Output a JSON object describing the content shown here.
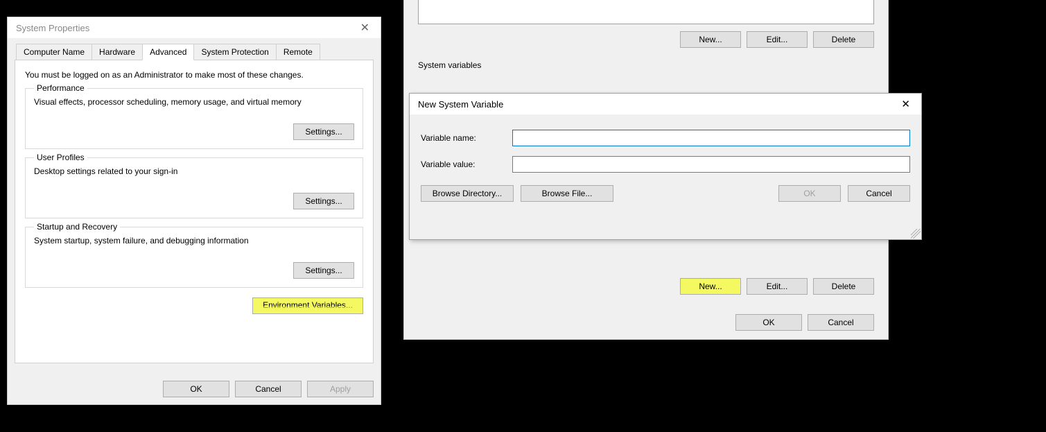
{
  "sysprop": {
    "title": "System Properties",
    "tabs": [
      "Computer Name",
      "Hardware",
      "Advanced",
      "System Protection",
      "Remote"
    ],
    "active_tab_index": 2,
    "admin_notice": "You must be logged on as an Administrator to make most of these changes.",
    "groups": {
      "performance": {
        "legend": "Performance",
        "desc": "Visual effects, processor scheduling, memory usage, and virtual memory",
        "settings_label": "Settings..."
      },
      "user_profiles": {
        "legend": "User Profiles",
        "desc": "Desktop settings related to your sign-in",
        "settings_label": "Settings..."
      },
      "startup": {
        "legend": "Startup and Recovery",
        "desc": "System startup, system failure, and debugging information",
        "settings_label": "Settings..."
      }
    },
    "envvars_button": "Environment Variables...",
    "footer": {
      "ok": "OK",
      "cancel": "Cancel",
      "apply": "Apply"
    }
  },
  "envwin": {
    "user_buttons": {
      "new": "New...",
      "edit": "Edit...",
      "delete": "Delete"
    },
    "system_label": "System variables",
    "system_buttons": {
      "new": "New...",
      "edit": "Edit...",
      "delete": "Delete"
    },
    "footer": {
      "ok": "OK",
      "cancel": "Cancel"
    }
  },
  "newvar": {
    "title": "New System Variable",
    "name_label": "Variable name:",
    "value_label": "Variable value:",
    "name_value": "",
    "value_value": "",
    "browse_dir": "Browse Directory...",
    "browse_file": "Browse File...",
    "ok": "OK",
    "cancel": "Cancel"
  }
}
